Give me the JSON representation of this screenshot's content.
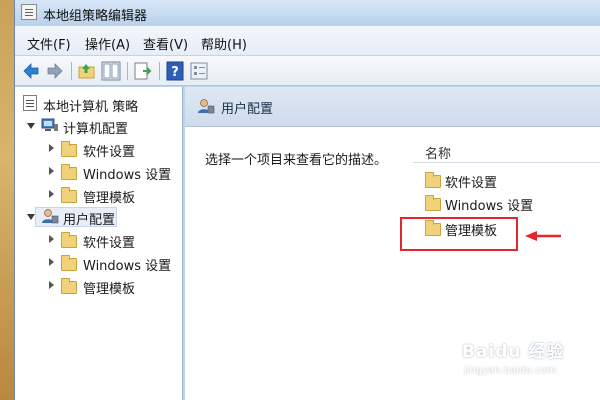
{
  "window": {
    "title": "本地组策略编辑器"
  },
  "menu": [
    {
      "label": "文件(F)"
    },
    {
      "label": "操作(A)"
    },
    {
      "label": "查看(V)"
    },
    {
      "label": "帮助(H)"
    }
  ],
  "toolbar": {
    "buttons": [
      {
        "icon": "back-arrow-icon"
      },
      {
        "icon": "forward-arrow-icon"
      },
      {
        "icon": "up-folder-icon"
      },
      {
        "icon": "show-hide-tree-icon"
      },
      {
        "icon": "export-list-icon"
      },
      {
        "icon": "help-icon"
      },
      {
        "icon": "properties-icon"
      }
    ]
  },
  "tree": {
    "root": "本地计算机 策略",
    "computer_config": {
      "label": "计算机配置",
      "children": [
        "软件设置",
        "Windows 设置",
        "管理模板"
      ]
    },
    "user_config": {
      "label": "用户配置",
      "children": [
        "软件设置",
        "Windows 设置",
        "管理模板"
      ]
    }
  },
  "right_pane": {
    "header": "用户配置",
    "description": "选择一个项目来查看它的描述。",
    "column_name": "名称",
    "items": [
      "软件设置",
      "Windows 设置",
      "管理模板"
    ]
  },
  "annotation": {
    "color": "#e2262b"
  },
  "watermark": {
    "logo": "Baidu 经验",
    "sub": "jingyan.baidu.com"
  }
}
